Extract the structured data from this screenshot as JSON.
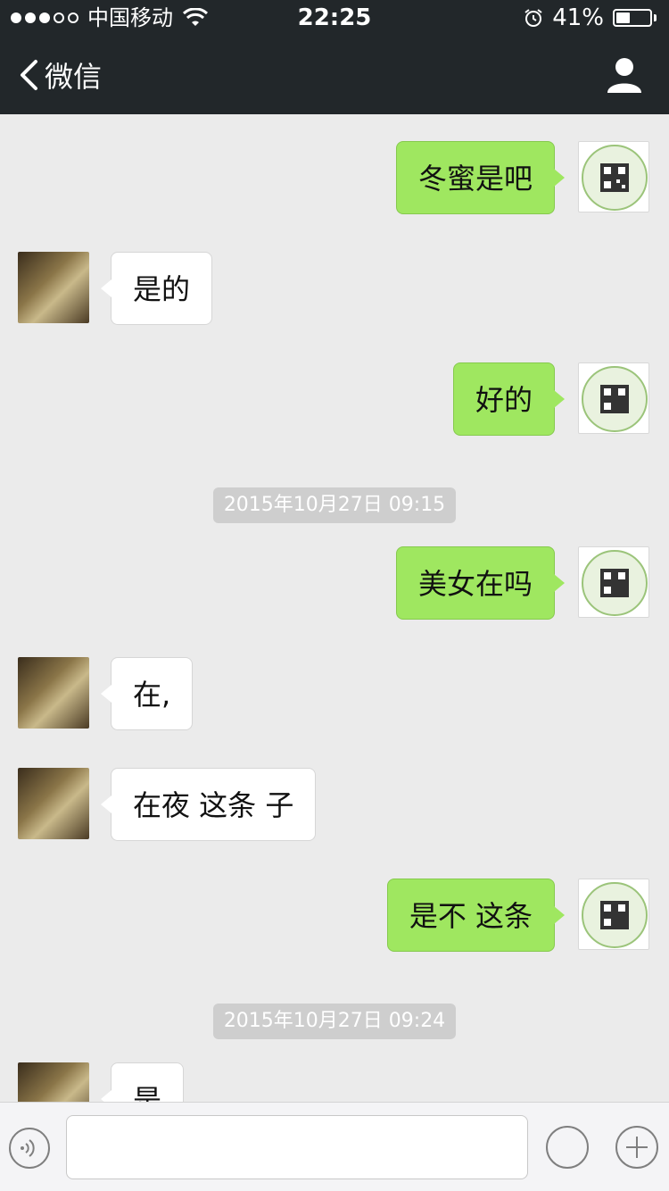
{
  "status_bar": {
    "carrier": "中国移动",
    "time": "22:25",
    "battery": "41%",
    "battery_level": 0.41
  },
  "nav": {
    "back_label": "微信",
    "title": ""
  },
  "messages": [
    {
      "side": "mine",
      "text": "冬蜜是吧"
    },
    {
      "side": "theirs",
      "text": "是的"
    },
    {
      "side": "mine",
      "text": "好的"
    },
    {
      "type": "timestamp",
      "text": "2015年10月27日 09:15"
    },
    {
      "side": "mine",
      "text": "美女在吗"
    },
    {
      "side": "theirs",
      "text": "在,"
    },
    {
      "side": "theirs",
      "text": "在夜 这条 子"
    },
    {
      "side": "mine",
      "text": "是不 这条"
    },
    {
      "type": "timestamp",
      "text": "2015年10月27日 09:24"
    },
    {
      "side": "theirs",
      "text": "是"
    }
  ],
  "input": {
    "placeholder": ""
  },
  "watermark": "",
  "colors": {
    "header_bg": "#22272a",
    "chat_bg": "#ebebeb",
    "mine_bubble": "#9fe760",
    "theirs_bubble": "#ffffff"
  }
}
